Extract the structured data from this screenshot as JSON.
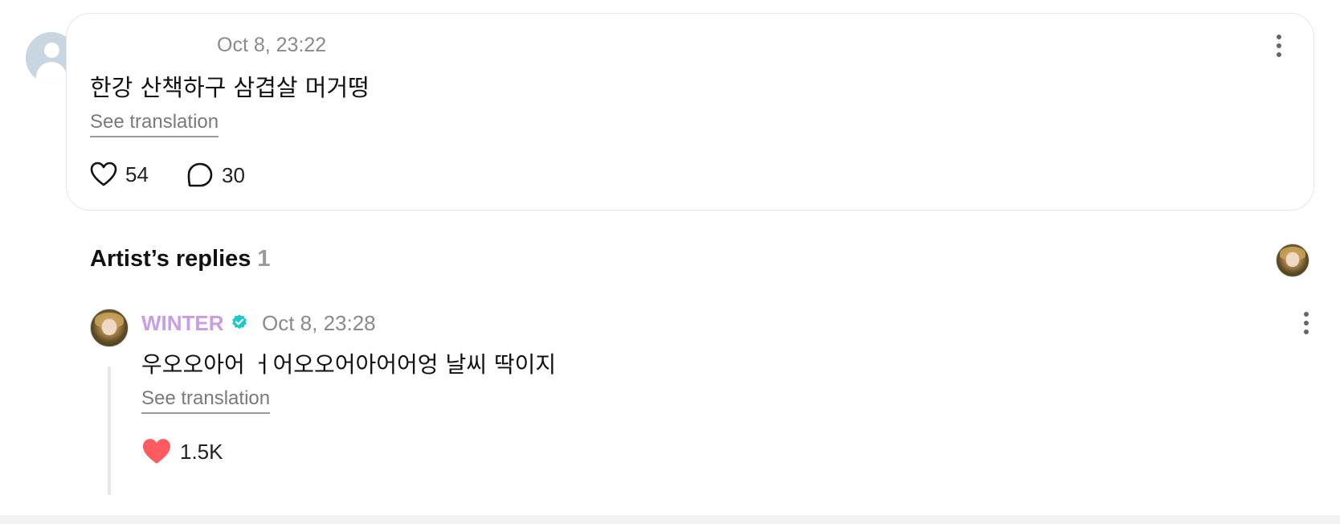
{
  "comment": {
    "timestamp": "Oct 8, 23:22",
    "text": "한강 산책하구 삼겹살 머거떵",
    "see_translation": "See translation",
    "likes": "54",
    "replies": "30"
  },
  "artist_replies": {
    "title": "Artist’s replies",
    "count": "1",
    "reply": {
      "author": "WINTER",
      "timestamp": "Oct 8, 23:28",
      "text": "우오오아어 ㅓ어오오어아어어엉 날씨 딱이지",
      "see_translation": "See translation",
      "likes": "1.5K"
    }
  },
  "colors": {
    "author_name": "#c89ce6",
    "verified_badge": "#1ec8c8",
    "liked_heart": "#ff5a5f"
  },
  "icons": [
    "user-avatar-placeholder-icon",
    "heart-icon",
    "comment-bubble-icon",
    "more-options-icon",
    "verified-badge-icon",
    "heart-filled-icon"
  ]
}
